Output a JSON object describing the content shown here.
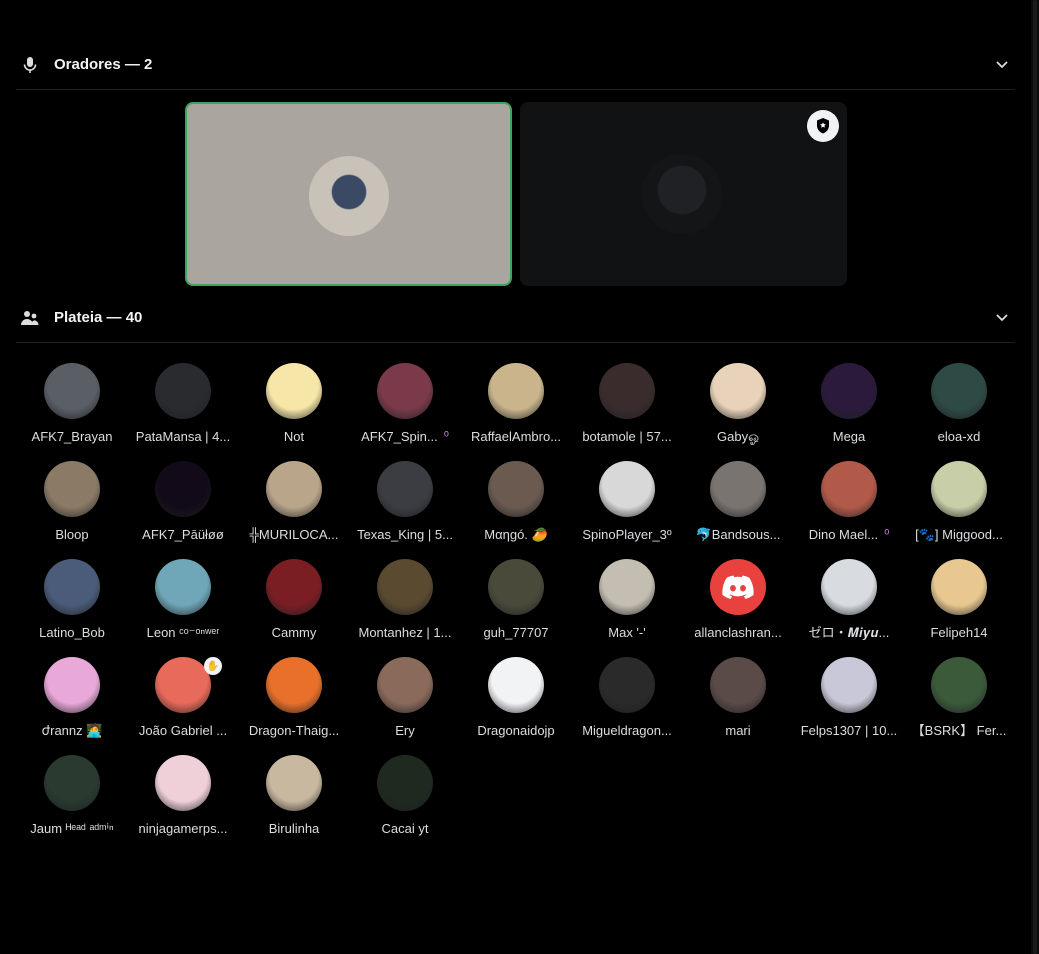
{
  "speakers_section": {
    "title": "Oradores — 2",
    "icon": "microphone-icon"
  },
  "audience_section": {
    "title": "Plateia — 40",
    "icon": "audience-icon"
  },
  "colors": {
    "speaking_border": "#3ba55c",
    "background": "#000000",
    "tile_dark": "#111214",
    "tile_light": "#aaa59e"
  },
  "audience": [
    {
      "name": "AFK7_Brayan",
      "color": "#5a5f66"
    },
    {
      "name": "PataMansa | 4...",
      "color": "#2a2b2f"
    },
    {
      "name": "Not",
      "color": "#f6e6a8"
    },
    {
      "name": "AFK7_Spin...",
      "color": "#7a3a4a",
      "tag": "⁰"
    },
    {
      "name": "RaffaelAmbro...",
      "color": "#c9b48c"
    },
    {
      "name": "botamole | 57...",
      "color": "#3a2c2c"
    },
    {
      "name": "Gabyஓ",
      "color": "#e8d2b9"
    },
    {
      "name": "Mega",
      "color": "#2b1a3c"
    },
    {
      "name": "eloa-xd",
      "color": "#2e4a44"
    },
    {
      "name": "Bloop",
      "color": "#8a7a66"
    },
    {
      "name": "AFK7_Pāüłøø",
      "color": "#120a18"
    },
    {
      "name": "╬MURILOCA...",
      "color": "#b9a68a"
    },
    {
      "name": "Texas_King | 5...",
      "color": "#3c3d42"
    },
    {
      "name": "Mαηgó. 🥭",
      "color": "#6a5a50"
    },
    {
      "name": "SpinoPlayer_3º",
      "color": "#d8d8d8"
    },
    {
      "name": "🐬Bandsous...",
      "color": "#7a7470"
    },
    {
      "name": "Dino Mael...",
      "color": "#b25a4a",
      "tag": "⁰"
    },
    {
      "name": "[🐾] Miggood...",
      "color": "#c8cfa8"
    },
    {
      "name": "Latino_Bob",
      "color": "#4a5c7a"
    },
    {
      "name": "Leon ᶜᵒ⁻ᵒⁿʷᵉʳ",
      "color": "#6fa6b8"
    },
    {
      "name": "Cammy",
      "color": "#7a1e24"
    },
    {
      "name": "Montanhez | 1...",
      "color": "#5a4a30"
    },
    {
      "name": "guh_77707",
      "color": "#4a4a3a"
    },
    {
      "name": "Max '-'",
      "color": "#c4beb2"
    },
    {
      "name": "allanclashran...",
      "color": "#e8413e",
      "discord": true
    },
    {
      "name": "ゼロ・𝑴𝒊𝒚𝒖...",
      "color": "#d8dce0"
    },
    {
      "name": "Felipeh14",
      "color": "#e8c890"
    },
    {
      "name": "ժrannz 🧑‍💻",
      "color": "#e8a8d8"
    },
    {
      "name": "João Gabriel ...",
      "color": "#e86a5a",
      "hand": true
    },
    {
      "name": "Dragon-Thaig...",
      "color": "#e8702a"
    },
    {
      "name": "Ery",
      "color": "#8a6a5a"
    },
    {
      "name": "Dragonaidojp",
      "color": "#f2f3f5"
    },
    {
      "name": "Migueldragon...",
      "color": "#2a2a2a"
    },
    {
      "name": "mari",
      "color": "#5a4a48"
    },
    {
      "name": "Felps1307 | 10...",
      "color": "#c8c8d8"
    },
    {
      "name": "【BSRK】 Fer...",
      "color": "#3a5a3a"
    },
    {
      "name": "Jaum ᴴᵉᵃᵈ ᵃᵈᵐⁱⁿ",
      "color": "#2a3a30"
    },
    {
      "name": "ninjagamerps...",
      "color": "#f0d0d8"
    },
    {
      "name": "Birulinha",
      "color": "#c8b8a0"
    },
    {
      "name": "Cacai yt",
      "color": "#1e2a20"
    }
  ]
}
